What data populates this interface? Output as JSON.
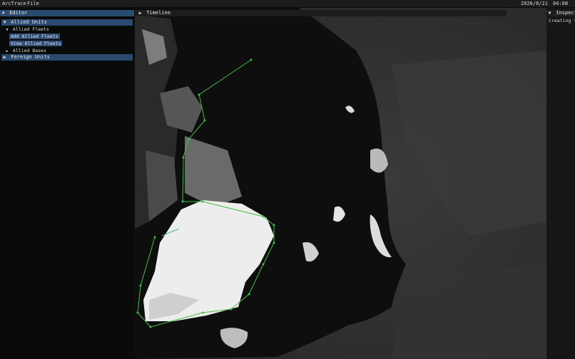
{
  "menubar": {
    "app_name": "ArcTrace",
    "file_menu": "File",
    "date": "2026/8/21",
    "time": "04:08"
  },
  "editor": {
    "title": "Editor",
    "allied_units": "Allied Units",
    "allied_fleets": "Allied Fleets",
    "add_allied_fleets": "Add Allied Fleets",
    "view_allied_fleets": "View Allied Fleets",
    "allied_bases": "Allied Bases",
    "foreign_units": "Foreign Units"
  },
  "timeline": {
    "title": "Timeline"
  },
  "inspector": {
    "title": "Inspector",
    "status": "Creating fl"
  },
  "colors": {
    "accent": "#2b4a6f",
    "button": "#2f4f78",
    "route": "#3fbf3f"
  }
}
